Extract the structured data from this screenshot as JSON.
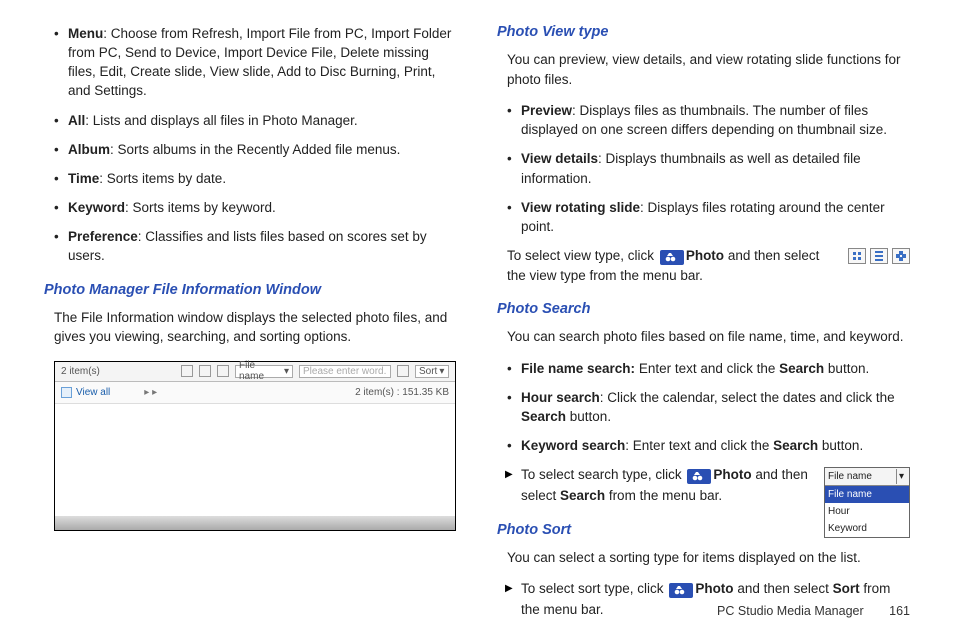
{
  "left": {
    "bullets": {
      "menu_label": "Menu",
      "menu_text": ": Choose from Refresh, Import File from PC, Import Folder from PC, Send to Device, Import Device File, Delete missing files, Edit, Create slide, View slide, Add to Disc Burning, Print, and Settings.",
      "all_label": "All",
      "all_text": ": Lists and displays all files in Photo Manager.",
      "album_label": "Album",
      "album_text": ": Sorts albums in the Recently Added file menus.",
      "time_label": "Time",
      "time_text": ": Sorts items by date.",
      "keyword_label": "Keyword",
      "keyword_text": ": Sorts items by keyword.",
      "pref_label": "Preference",
      "pref_text": ": Classifies and lists files based on scores set by users."
    },
    "heading_fileinfo": "Photo Manager File Information Window",
    "fileinfo_para": "The File Information window displays the selected photo files, and gives you viewing, searching, and sorting options.",
    "figure": {
      "count_label": "2 item(s)",
      "filename_label": "File name",
      "placeholder": "Please enter word.",
      "sort_label": "Sort",
      "view_all": "View all",
      "items_info": "2 item(s) : 151.35 KB"
    }
  },
  "right": {
    "heading_viewtype": "Photo View type",
    "viewtype_para": "You can preview, view details, and view rotating slide functions for photo files.",
    "preview_label": "Preview",
    "preview_text": ": Displays files as thumbnails. The number of files displayed on one screen differs depending on thumbnail size.",
    "viewdetails_label": "View details",
    "viewdetails_text": ": Displays thumbnails as well as detailed file information.",
    "viewrot_label": "View rotating slide",
    "viewrot_text": ": Displays files rotating around the center point.",
    "viewtype_select_a": "To select view type, click ",
    "photo_word": "Photo",
    "viewtype_select_b": " and then select the view type  from the menu bar.",
    "heading_search": "Photo Search",
    "search_para": "You can search photo files based on file name, time, and keyword.",
    "fname_label": "File name search:",
    "fname_text": " Enter text and click the ",
    "search_btn": "Search",
    "fname_text2": " button.",
    "hour_label": "Hour search",
    "hour_text": ": Click the calendar, select the dates and click the ",
    "hour_text2": " button.",
    "kw_label": "Keyword search",
    "kw_text": ": Enter text and click the ",
    "kw_text2": " button.",
    "search_select_a": "To select search type, click ",
    "search_select_b": " and then select ",
    "search_word": "Search",
    "search_select_c": "  from the menu bar.",
    "dropdown": {
      "top": "File name",
      "opt1": "File name",
      "opt2": "Hour",
      "opt3": "Keyword"
    },
    "heading_sort": "Photo Sort",
    "sort_para": "You can select a sorting type for items displayed on the list.",
    "sort_select_a": "To select sort type, click ",
    "sort_select_b": " and then select ",
    "sort_word": "Sort",
    "sort_select_c": " from the menu bar."
  },
  "footer": {
    "section": "PC Studio Media Manager",
    "page": "161"
  }
}
